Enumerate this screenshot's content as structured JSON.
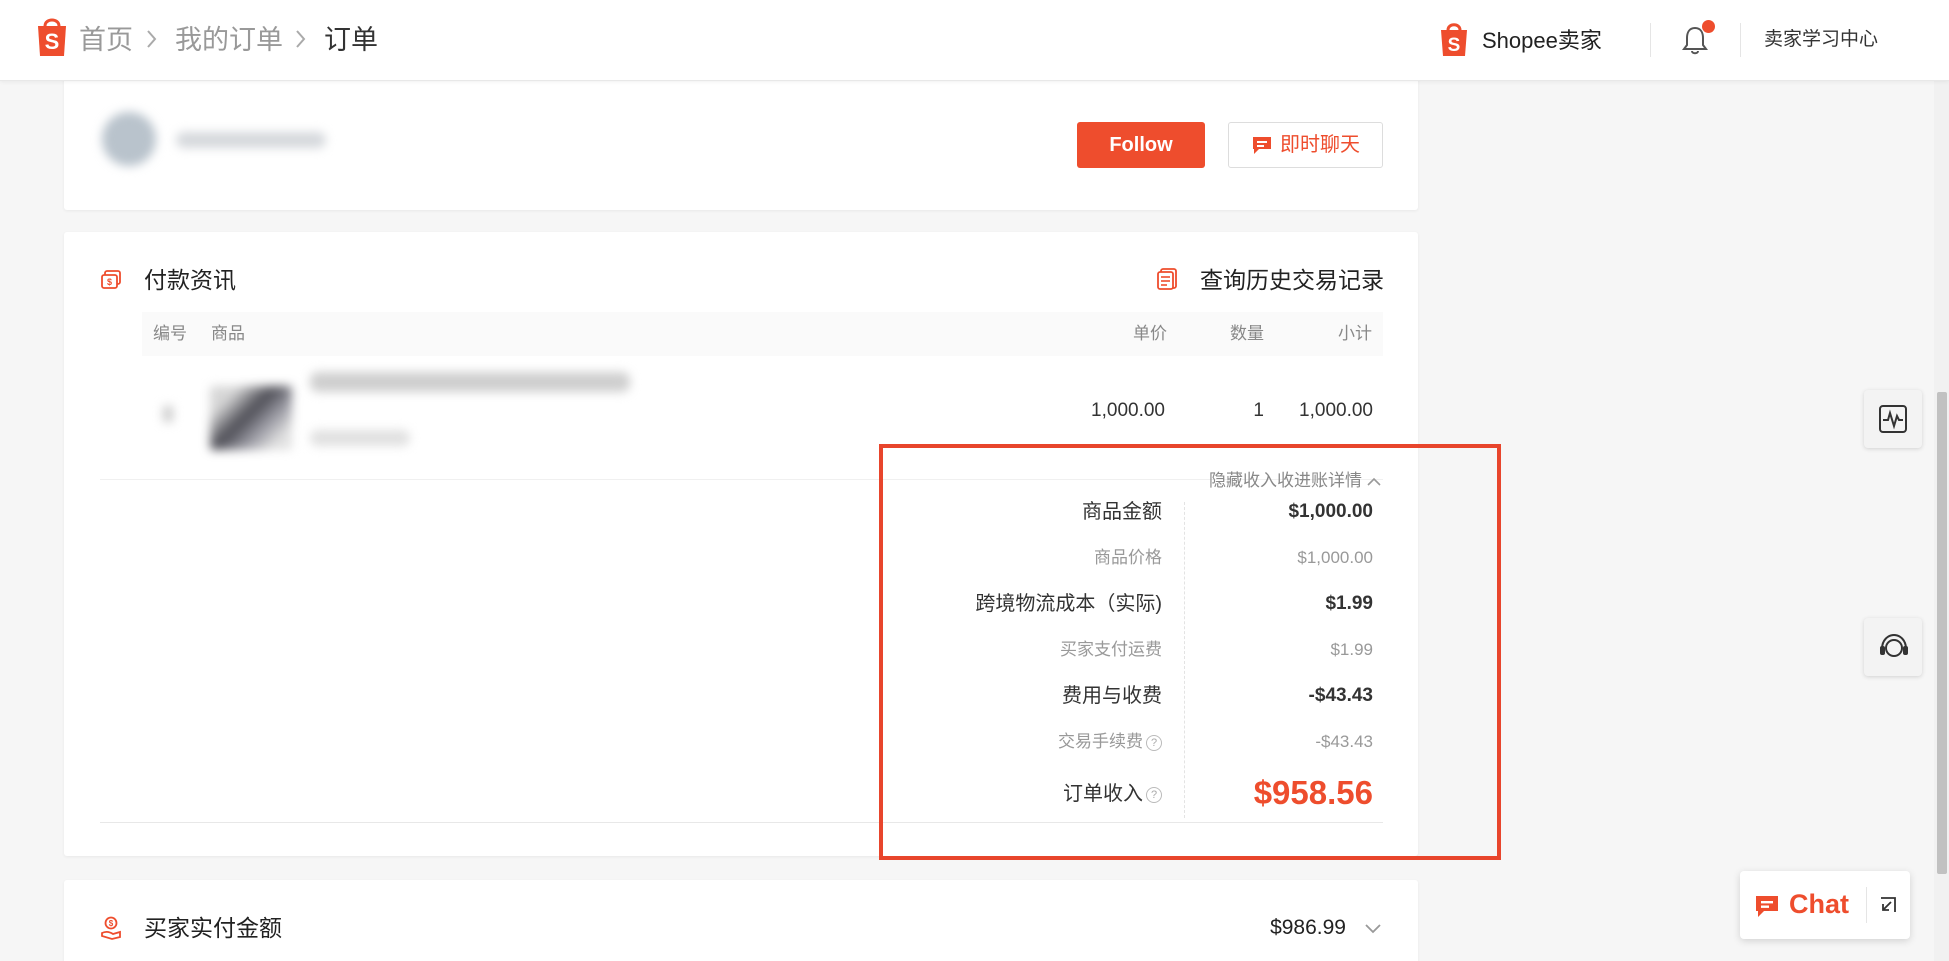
{
  "breadcrumb": {
    "home": "首页",
    "orders": "我的订单",
    "current": "订单"
  },
  "topbar": {
    "seller_brand": "Shopee卖家",
    "learning_center": "卖家学习中心"
  },
  "shop": {
    "follow_label": "Follow",
    "chat_label": "即时聊天"
  },
  "payment": {
    "title": "付款资讯",
    "history_link": "查询历史交易记录",
    "columns": {
      "no": "编号",
      "product": "商品",
      "unit_price": "单价",
      "qty": "数量",
      "subtotal": "小计"
    },
    "item": {
      "unit_price": "1,000.00",
      "qty": "1",
      "subtotal": "1,000.00"
    },
    "toggle_label": "隐藏收入收进账详情",
    "breakdown": {
      "product_amount_label": "商品金额",
      "product_amount": "$1,000.00",
      "product_price_label": "商品价格",
      "product_price": "$1,000.00",
      "shipping_label": "跨境物流成本（实际)",
      "shipping": "$1.99",
      "buyer_shipping_label": "买家支付运费",
      "buyer_shipping": "$1.99",
      "fees_label": "费用与收费",
      "fees": "-$43.43",
      "txn_fee_label": "交易手续费",
      "txn_fee": "-$43.43",
      "income_label": "订单收入",
      "income": "$958.56"
    }
  },
  "buyer_paid": {
    "title": "买家实付金额",
    "amount": "$986.99"
  },
  "chat_widget": {
    "label": "Chat"
  },
  "colors": {
    "brand": "#ee4d2d",
    "highlight": "#e8452c"
  }
}
